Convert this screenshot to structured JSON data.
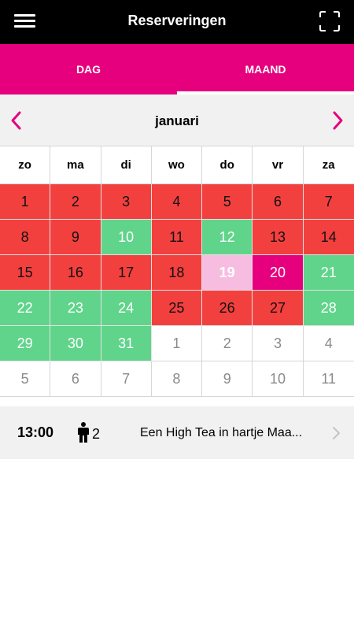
{
  "header": {
    "title": "Reserveringen",
    "icons": {
      "menu": "hamburger-menu-icon",
      "scan": "scan-frame-icon"
    }
  },
  "tabs": [
    {
      "label": "DAG",
      "active": false
    },
    {
      "label": "MAAND",
      "active": true
    }
  ],
  "calendar": {
    "month": "januari",
    "weekdays": [
      "zo",
      "ma",
      "di",
      "wo",
      "do",
      "vr",
      "za"
    ],
    "weeks": [
      [
        {
          "day": "1",
          "status": "red"
        },
        {
          "day": "2",
          "status": "red"
        },
        {
          "day": "3",
          "status": "red"
        },
        {
          "day": "4",
          "status": "red"
        },
        {
          "day": "5",
          "status": "red"
        },
        {
          "day": "6",
          "status": "red"
        },
        {
          "day": "7",
          "status": "red"
        }
      ],
      [
        {
          "day": "8",
          "status": "red"
        },
        {
          "day": "9",
          "status": "red"
        },
        {
          "day": "10",
          "status": "green"
        },
        {
          "day": "11",
          "status": "red"
        },
        {
          "day": "12",
          "status": "green"
        },
        {
          "day": "13",
          "status": "red"
        },
        {
          "day": "14",
          "status": "red"
        }
      ],
      [
        {
          "day": "15",
          "status": "red"
        },
        {
          "day": "16",
          "status": "red"
        },
        {
          "day": "17",
          "status": "red"
        },
        {
          "day": "18",
          "status": "red"
        },
        {
          "day": "19",
          "status": "today"
        },
        {
          "day": "20",
          "status": "selected"
        },
        {
          "day": "21",
          "status": "green"
        }
      ],
      [
        {
          "day": "22",
          "status": "green"
        },
        {
          "day": "23",
          "status": "green"
        },
        {
          "day": "24",
          "status": "green"
        },
        {
          "day": "25",
          "status": "red"
        },
        {
          "day": "26",
          "status": "red"
        },
        {
          "day": "27",
          "status": "red"
        },
        {
          "day": "28",
          "status": "green"
        }
      ],
      [
        {
          "day": "29",
          "status": "green"
        },
        {
          "day": "30",
          "status": "green"
        },
        {
          "day": "31",
          "status": "green"
        },
        {
          "day": "1",
          "status": "other"
        },
        {
          "day": "2",
          "status": "other"
        },
        {
          "day": "3",
          "status": "other"
        },
        {
          "day": "4",
          "status": "other"
        }
      ],
      [
        {
          "day": "5",
          "status": "other"
        },
        {
          "day": "6",
          "status": "other"
        },
        {
          "day": "7",
          "status": "other"
        },
        {
          "day": "8",
          "status": "other"
        },
        {
          "day": "9",
          "status": "other"
        },
        {
          "day": "10",
          "status": "other"
        },
        {
          "day": "11",
          "status": "other"
        }
      ]
    ]
  },
  "reservations": [
    {
      "time": "13:00",
      "guests": "2",
      "title": "Een High Tea in hartje Maa..."
    }
  ],
  "colors": {
    "accent": "#e6007e",
    "full": "#f2403f",
    "available": "#5fd48a",
    "today": "#f7bde0"
  }
}
